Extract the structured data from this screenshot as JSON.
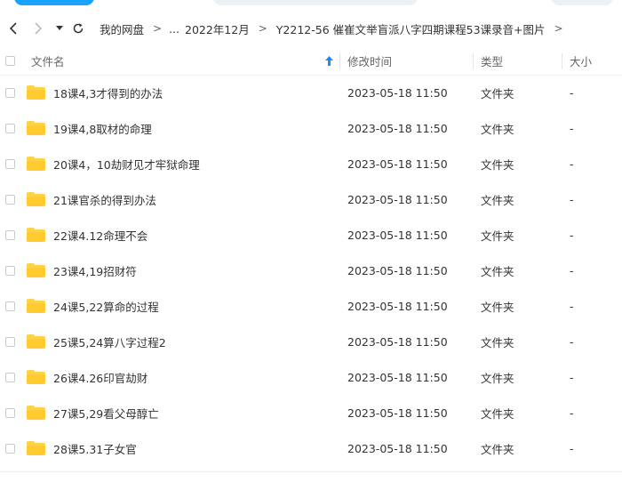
{
  "nav": {
    "icons": {
      "back": "chevron-left-icon",
      "forward": "chevron-right-icon",
      "dropdown": "caret-down-icon",
      "refresh": "refresh-icon"
    }
  },
  "breadcrumb": {
    "items": [
      "我的网盘",
      "...",
      "2022年12月",
      "Y2212-56 催崔文举盲派八字四期课程53课录音+图片"
    ],
    "separator": ">"
  },
  "table": {
    "headers": {
      "name": "文件名",
      "modified": "修改时间",
      "type": "类型",
      "size": "大小"
    },
    "sort_icon": "sort-up-arrow-icon",
    "accent_color": "#1a8cff",
    "rows": [
      {
        "name": "18课4,3才得到的办法",
        "modified": "2023-05-18 11:50",
        "type": "文件夹",
        "size": "-"
      },
      {
        "name": "19课4,8取材的命理",
        "modified": "2023-05-18 11:50",
        "type": "文件夹",
        "size": "-"
      },
      {
        "name": "20课4，10劫财见才牢狱命理",
        "modified": "2023-05-18 11:50",
        "type": "文件夹",
        "size": "-"
      },
      {
        "name": "21课官杀的得到办法",
        "modified": "2023-05-18 11:50",
        "type": "文件夹",
        "size": "-"
      },
      {
        "name": "22课4.12命理不会",
        "modified": "2023-05-18 11:50",
        "type": "文件夹",
        "size": "-"
      },
      {
        "name": "23课4,19招财符",
        "modified": "2023-05-18 11:50",
        "type": "文件夹",
        "size": "-"
      },
      {
        "name": "24课5,22算命的过程",
        "modified": "2023-05-18 11:50",
        "type": "文件夹",
        "size": "-"
      },
      {
        "name": "25课5,24算八字过程2",
        "modified": "2023-05-18 11:50",
        "type": "文件夹",
        "size": "-"
      },
      {
        "name": "26课4.26印官劫财",
        "modified": "2023-05-18 11:50",
        "type": "文件夹",
        "size": "-"
      },
      {
        "name": "27课5,29看父母醇亡",
        "modified": "2023-05-18 11:50",
        "type": "文件夹",
        "size": "-"
      },
      {
        "name": "28课5.31子女官",
        "modified": "2023-05-18 11:50",
        "type": "文件夹",
        "size": "-"
      }
    ]
  }
}
